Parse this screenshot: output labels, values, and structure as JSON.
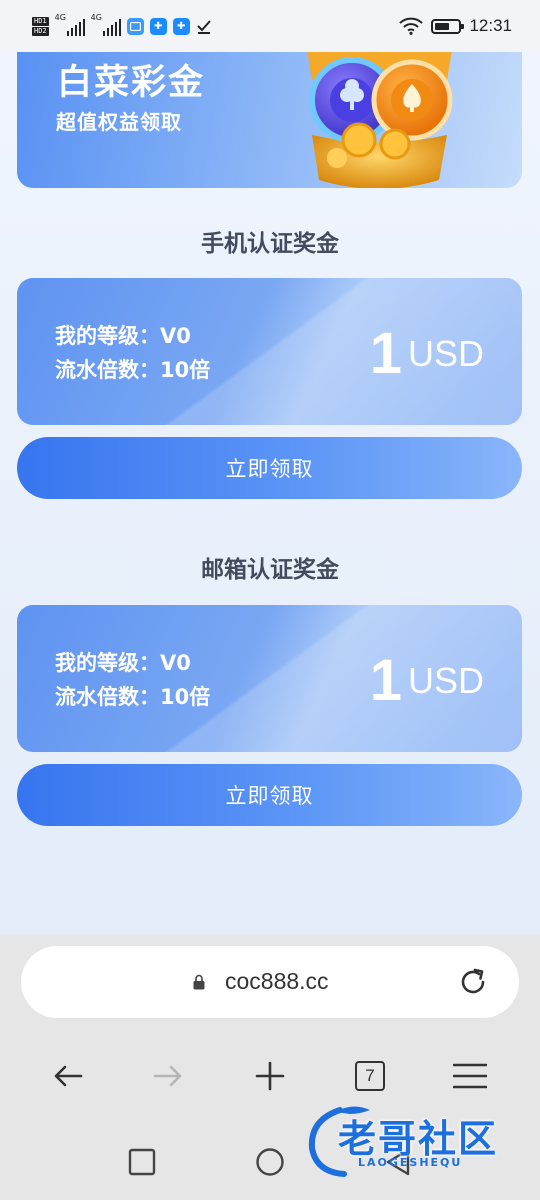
{
  "status_bar": {
    "sim1": "HD1",
    "sim2": "HD2",
    "net1": "4G",
    "net2": "4G",
    "time": "12:31",
    "icons": [
      "signal-icon",
      "app-notification-icon",
      "puzzle-icon",
      "download-done-icon",
      "wifi-icon",
      "battery-icon"
    ]
  },
  "banner": {
    "title": "白菜彩金",
    "subtitle": "超值权益领取",
    "image": "treasure-chest-poker-chips"
  },
  "bonuses": [
    {
      "section_title": "手机认证奖金",
      "level_line": "我的等级：V0",
      "turnover_line": "流水倍数：10倍",
      "amount": "1",
      "currency": "USD",
      "button_label": "立即领取"
    },
    {
      "section_title": "邮箱认证奖金",
      "level_line": "我的等级：V0",
      "turnover_line": "流水倍数：10倍",
      "amount": "1",
      "currency": "USD",
      "button_label": "立即领取"
    }
  ],
  "browser": {
    "url": "coc888.cc",
    "tab_count": "7",
    "nav_icons": [
      "back-icon",
      "forward-icon",
      "new-tab-icon",
      "tabs-icon",
      "menu-icon"
    ]
  },
  "watermark": {
    "text": "老哥社区",
    "sub": "LAOGESHEQU"
  },
  "colors": {
    "accent": "#3775f0",
    "card": "#7aa7f3",
    "title_text": "#434c5e"
  }
}
